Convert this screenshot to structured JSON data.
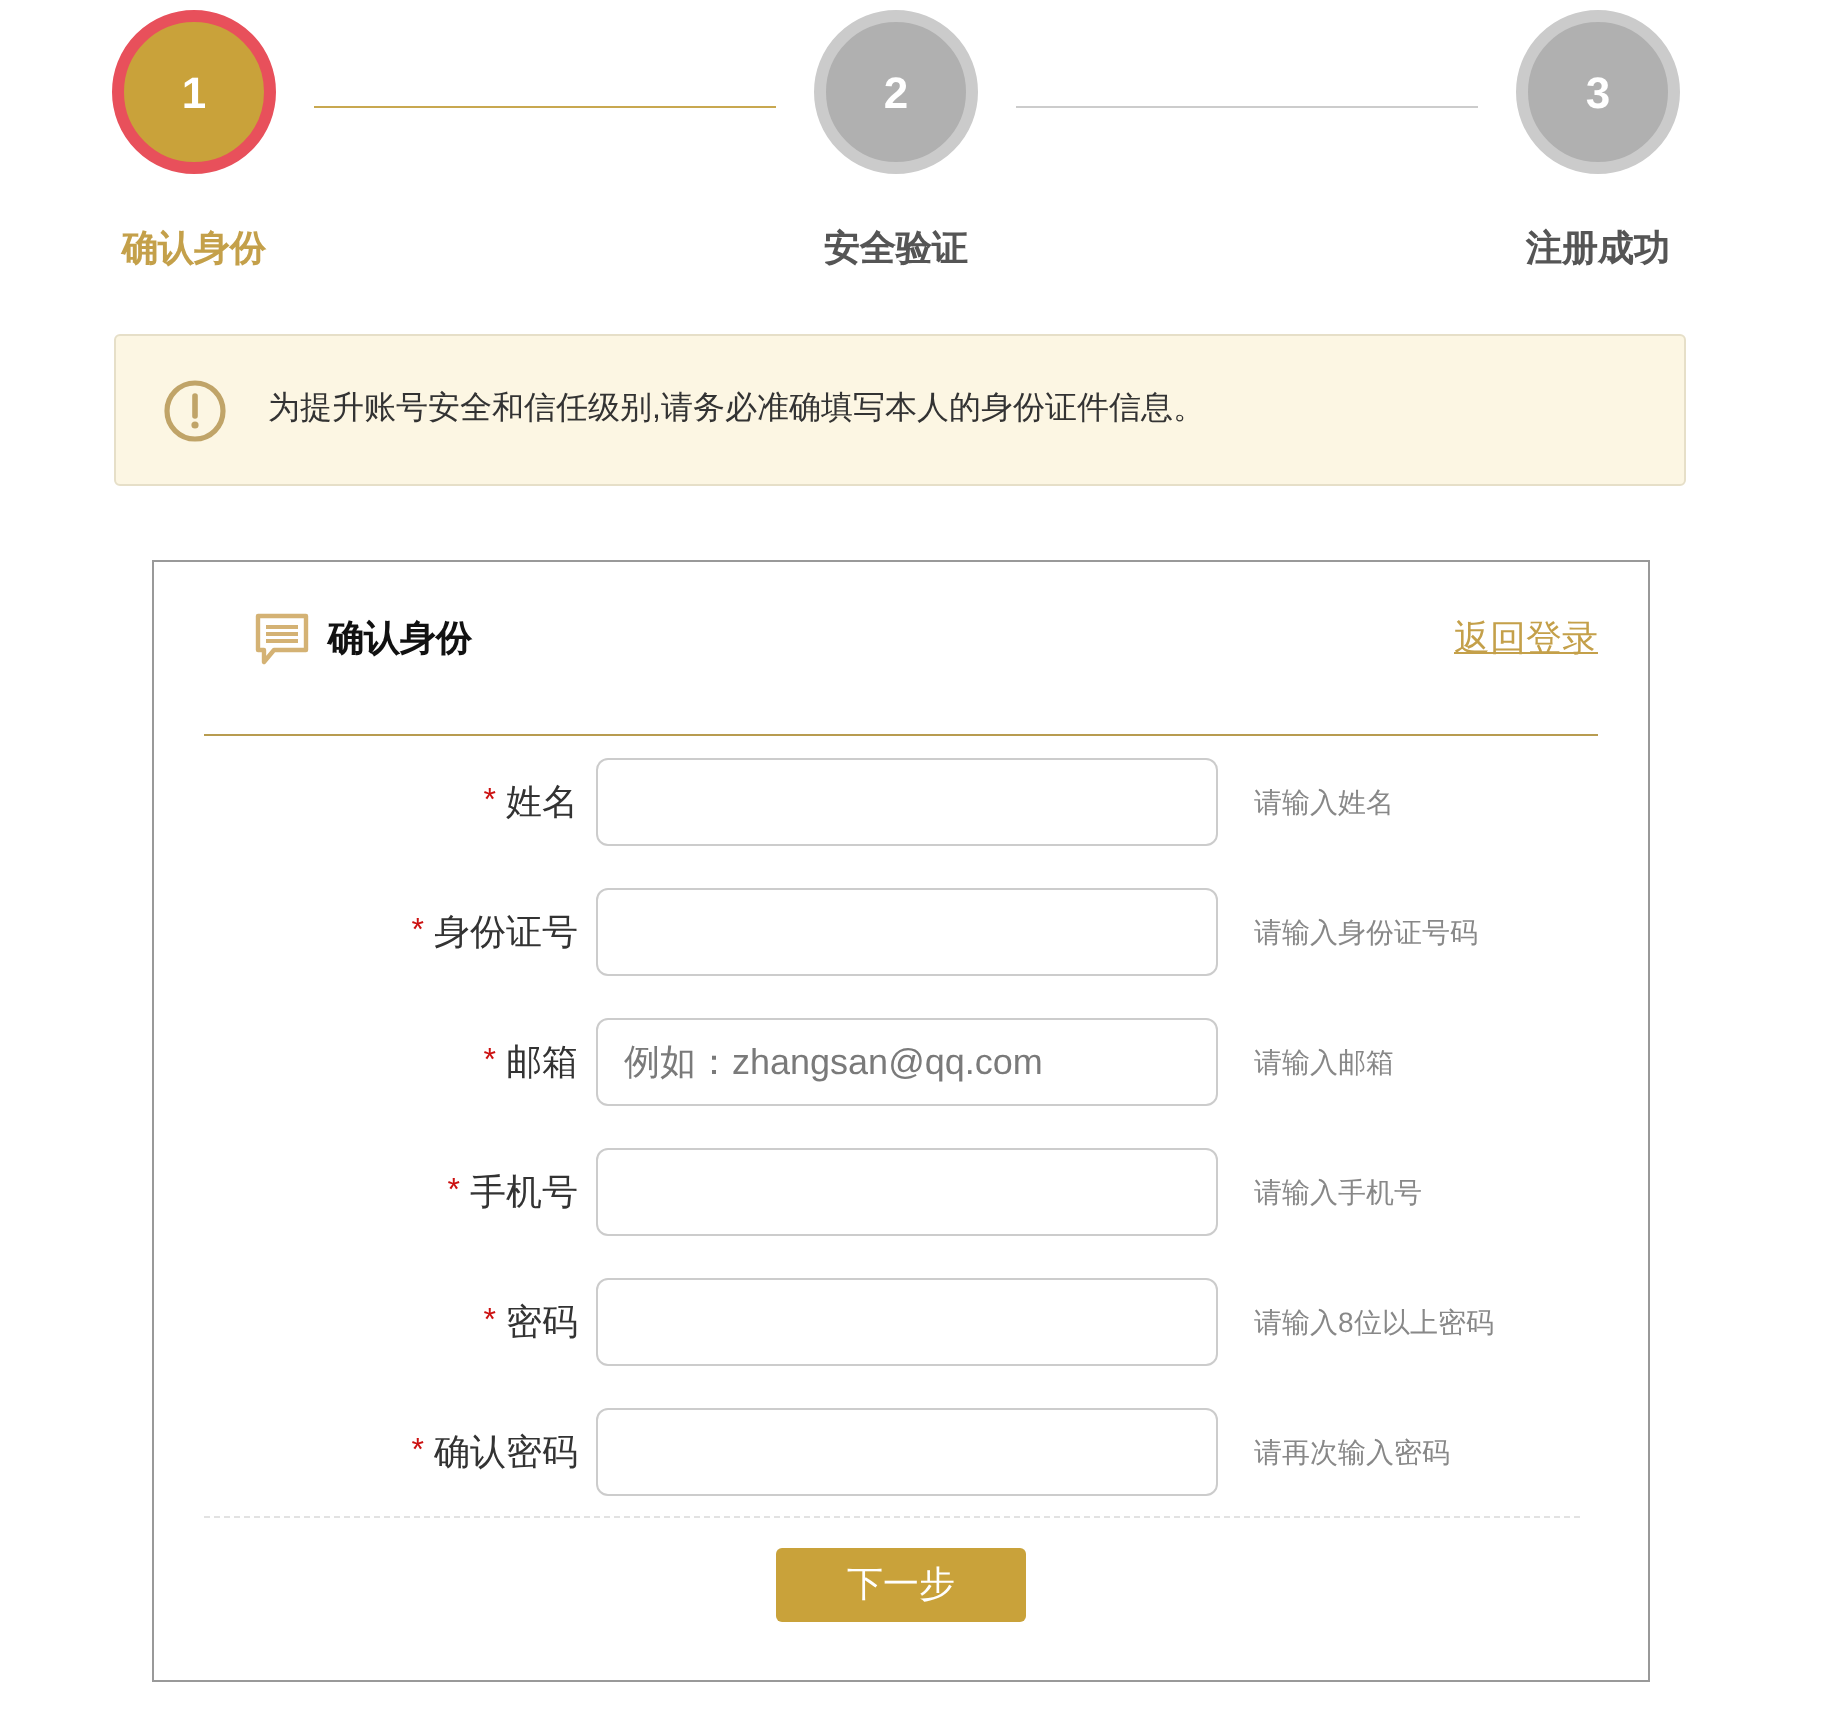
{
  "steps": [
    {
      "number": "1",
      "label": "确认身份",
      "active": true
    },
    {
      "number": "2",
      "label": "安全验证",
      "active": false
    },
    {
      "number": "3",
      "label": "注册成功",
      "active": false
    }
  ],
  "notice": {
    "text": "为提升账号安全和信任级别,请务必准确填写本人的身份证件信息。"
  },
  "form": {
    "title": "确认身份",
    "back_link": "返回登录",
    "fields": [
      {
        "required_mark": "*",
        "label": "姓名",
        "hint": "请输入姓名"
      },
      {
        "required_mark": "*",
        "label": "身份证号",
        "hint": "请输入身份证号码"
      },
      {
        "required_mark": "*",
        "label": "邮箱",
        "placeholder": "例如：zhangsan@qq.com",
        "hint": "请输入邮箱"
      },
      {
        "required_mark": "*",
        "label": "手机号",
        "hint": "请输入手机号"
      },
      {
        "required_mark": "*",
        "label": "密码",
        "hint": "请输入8位以上密码"
      },
      {
        "required_mark": "*",
        "label": "确认密码",
        "hint": "请再次输入密码"
      }
    ],
    "submit": "下一步"
  }
}
